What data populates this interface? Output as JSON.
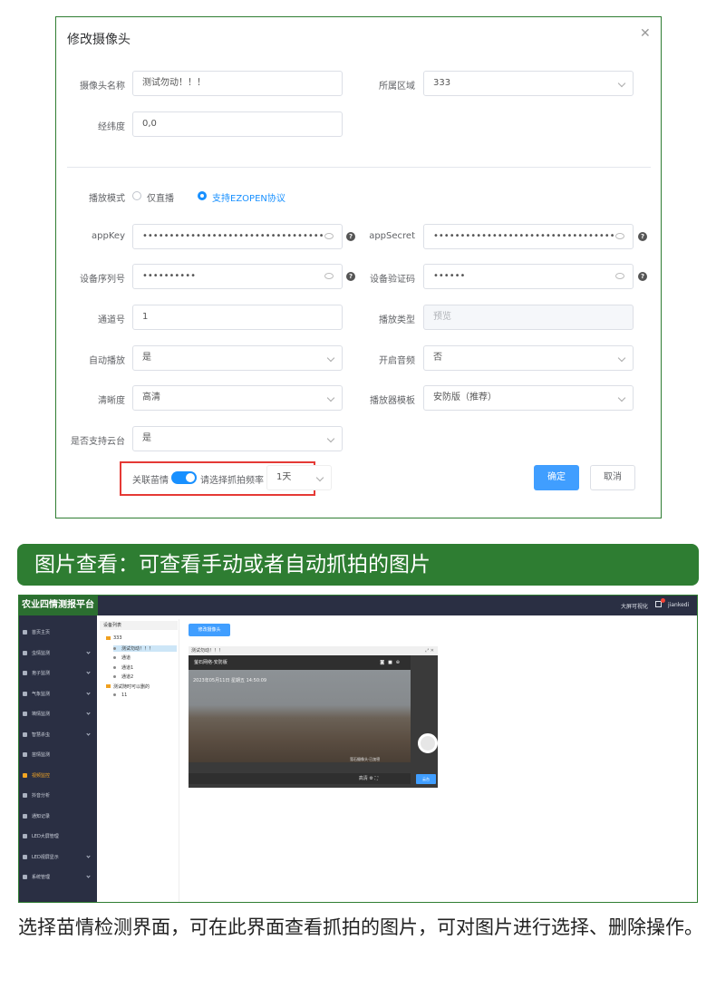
{
  "dialog": {
    "title": "修改摄像头",
    "fields": {
      "camera_name": {
        "label": "摄像头名称",
        "value": "测试勿动！！！"
      },
      "area": {
        "label": "所属区域",
        "value": "333"
      },
      "coords": {
        "label": "经纬度",
        "value": "0,0"
      },
      "play_mode": {
        "label": "播放模式",
        "option_live": "仅直播",
        "option_ezopen": "支持EZOPEN协议",
        "selected": "支持EZOPEN协议"
      },
      "app_key": {
        "label": "appKey",
        "value": "••••••••••••••••••••••••••••••••••"
      },
      "app_secret": {
        "label": "appSecret",
        "value": "••••••••••••••••••••••••••••••••••"
      },
      "serial": {
        "label": "设备序列号",
        "value": "••••••••••"
      },
      "verify_code": {
        "label": "设备验证码",
        "value": "••••••"
      },
      "channel": {
        "label": "通道号",
        "value": "1"
      },
      "play_type": {
        "label": "播放类型",
        "value": "预览"
      },
      "autoplay": {
        "label": "自动播放",
        "value": "是"
      },
      "audio": {
        "label": "开启音频",
        "value": "否"
      },
      "clarity": {
        "label": "清晰度",
        "value": "高清"
      },
      "template": {
        "label": "播放器模板",
        "value": "安防版（推荐）"
      },
      "ptz": {
        "label": "是否支持云台",
        "value": "是"
      },
      "link_seedling": {
        "label": "关联苗情",
        "enabled": true
      },
      "capture_freq": {
        "label": "请选择抓拍频率",
        "value": "1天"
      }
    },
    "confirm_label": "确定",
    "cancel_label": "取消"
  },
  "banner": {
    "text": "图片查看：可查看手动或者自动抓拍的图片"
  },
  "platform": {
    "brand": "农业四情测报平台",
    "top_right": {
      "screen_link": "大屏可视化",
      "user": "jiankedi"
    },
    "menu": [
      {
        "label": "首页主页",
        "has_children": false,
        "active": false
      },
      {
        "label": "虫情监测",
        "has_children": true,
        "active": false
      },
      {
        "label": "孢子监测",
        "has_children": true,
        "active": false
      },
      {
        "label": "气象监测",
        "has_children": true,
        "active": false
      },
      {
        "label": "墒情监测",
        "has_children": true,
        "active": false
      },
      {
        "label": "智慧杀虫",
        "has_children": true,
        "active": false
      },
      {
        "label": "苗情监测",
        "has_children": false,
        "active": false
      },
      {
        "label": "视频监控",
        "has_children": false,
        "active": true
      },
      {
        "label": "抖音分析",
        "has_children": false,
        "active": false
      },
      {
        "label": "通知记录",
        "has_children": false,
        "active": false
      },
      {
        "label": "LED大屏管理",
        "has_children": false,
        "active": false
      },
      {
        "label": "LED视屏显示",
        "has_children": true,
        "active": false
      },
      {
        "label": "系统管理",
        "has_children": true,
        "active": false
      }
    ],
    "tree": {
      "title": "设备列表",
      "nodes": [
        {
          "label": "333",
          "type": "folder",
          "selected": false
        },
        {
          "label": "测试勿动！！！",
          "type": "camera",
          "selected": true
        },
        {
          "label": "通道",
          "type": "camera",
          "selected": false
        },
        {
          "label": "通道1",
          "type": "camera",
          "selected": false
        },
        {
          "label": "通道2",
          "type": "camera",
          "selected": false
        },
        {
          "label": "测试随时可以删的",
          "type": "folder",
          "selected": false
        },
        {
          "label": "11",
          "type": "camera",
          "selected": false
        }
      ]
    },
    "add_camera_label": "修改摄像头",
    "video": {
      "tab_title": "测试勿动！！！",
      "bar_title": "萤石网络-安防版",
      "timestamp": "2023年05月11日 星期五 14:50:09",
      "watermark": "萤石摄像头·已加密",
      "quality": "高清",
      "ptz_label": "云台"
    }
  },
  "caption": "选择苗情检测界面，可在此界面查看抓拍的图片，可对图片进行选择、删除操作。"
}
